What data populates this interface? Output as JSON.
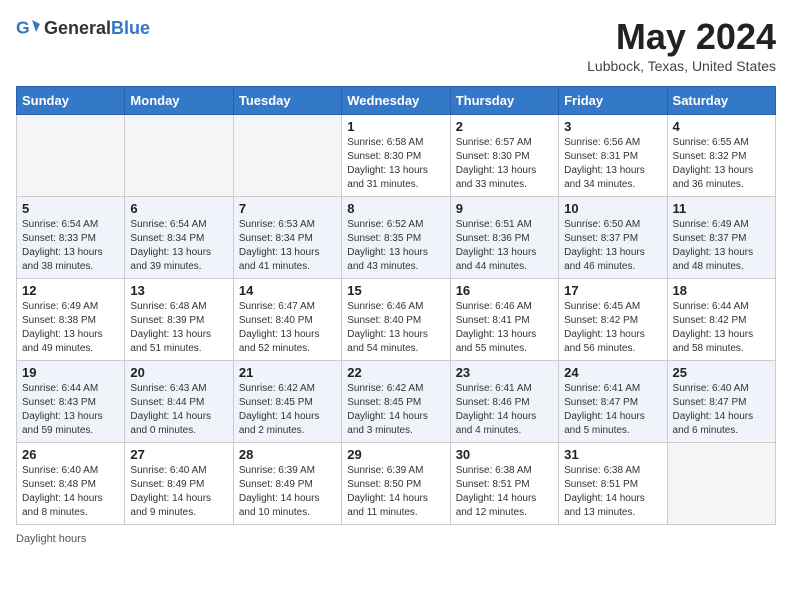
{
  "header": {
    "logo_general": "General",
    "logo_blue": "Blue",
    "month_title": "May 2024",
    "location": "Lubbock, Texas, United States"
  },
  "days_of_week": [
    "Sunday",
    "Monday",
    "Tuesday",
    "Wednesday",
    "Thursday",
    "Friday",
    "Saturday"
  ],
  "weeks": [
    [
      {
        "day": "",
        "info": ""
      },
      {
        "day": "",
        "info": ""
      },
      {
        "day": "",
        "info": ""
      },
      {
        "day": "1",
        "info": "Sunrise: 6:58 AM\nSunset: 8:30 PM\nDaylight: 13 hours\nand 31 minutes."
      },
      {
        "day": "2",
        "info": "Sunrise: 6:57 AM\nSunset: 8:30 PM\nDaylight: 13 hours\nand 33 minutes."
      },
      {
        "day": "3",
        "info": "Sunrise: 6:56 AM\nSunset: 8:31 PM\nDaylight: 13 hours\nand 34 minutes."
      },
      {
        "day": "4",
        "info": "Sunrise: 6:55 AM\nSunset: 8:32 PM\nDaylight: 13 hours\nand 36 minutes."
      }
    ],
    [
      {
        "day": "5",
        "info": "Sunrise: 6:54 AM\nSunset: 8:33 PM\nDaylight: 13 hours\nand 38 minutes."
      },
      {
        "day": "6",
        "info": "Sunrise: 6:54 AM\nSunset: 8:34 PM\nDaylight: 13 hours\nand 39 minutes."
      },
      {
        "day": "7",
        "info": "Sunrise: 6:53 AM\nSunset: 8:34 PM\nDaylight: 13 hours\nand 41 minutes."
      },
      {
        "day": "8",
        "info": "Sunrise: 6:52 AM\nSunset: 8:35 PM\nDaylight: 13 hours\nand 43 minutes."
      },
      {
        "day": "9",
        "info": "Sunrise: 6:51 AM\nSunset: 8:36 PM\nDaylight: 13 hours\nand 44 minutes."
      },
      {
        "day": "10",
        "info": "Sunrise: 6:50 AM\nSunset: 8:37 PM\nDaylight: 13 hours\nand 46 minutes."
      },
      {
        "day": "11",
        "info": "Sunrise: 6:49 AM\nSunset: 8:37 PM\nDaylight: 13 hours\nand 48 minutes."
      }
    ],
    [
      {
        "day": "12",
        "info": "Sunrise: 6:49 AM\nSunset: 8:38 PM\nDaylight: 13 hours\nand 49 minutes."
      },
      {
        "day": "13",
        "info": "Sunrise: 6:48 AM\nSunset: 8:39 PM\nDaylight: 13 hours\nand 51 minutes."
      },
      {
        "day": "14",
        "info": "Sunrise: 6:47 AM\nSunset: 8:40 PM\nDaylight: 13 hours\nand 52 minutes."
      },
      {
        "day": "15",
        "info": "Sunrise: 6:46 AM\nSunset: 8:40 PM\nDaylight: 13 hours\nand 54 minutes."
      },
      {
        "day": "16",
        "info": "Sunrise: 6:46 AM\nSunset: 8:41 PM\nDaylight: 13 hours\nand 55 minutes."
      },
      {
        "day": "17",
        "info": "Sunrise: 6:45 AM\nSunset: 8:42 PM\nDaylight: 13 hours\nand 56 minutes."
      },
      {
        "day": "18",
        "info": "Sunrise: 6:44 AM\nSunset: 8:42 PM\nDaylight: 13 hours\nand 58 minutes."
      }
    ],
    [
      {
        "day": "19",
        "info": "Sunrise: 6:44 AM\nSunset: 8:43 PM\nDaylight: 13 hours\nand 59 minutes."
      },
      {
        "day": "20",
        "info": "Sunrise: 6:43 AM\nSunset: 8:44 PM\nDaylight: 14 hours\nand 0 minutes."
      },
      {
        "day": "21",
        "info": "Sunrise: 6:42 AM\nSunset: 8:45 PM\nDaylight: 14 hours\nand 2 minutes."
      },
      {
        "day": "22",
        "info": "Sunrise: 6:42 AM\nSunset: 8:45 PM\nDaylight: 14 hours\nand 3 minutes."
      },
      {
        "day": "23",
        "info": "Sunrise: 6:41 AM\nSunset: 8:46 PM\nDaylight: 14 hours\nand 4 minutes."
      },
      {
        "day": "24",
        "info": "Sunrise: 6:41 AM\nSunset: 8:47 PM\nDaylight: 14 hours\nand 5 minutes."
      },
      {
        "day": "25",
        "info": "Sunrise: 6:40 AM\nSunset: 8:47 PM\nDaylight: 14 hours\nand 6 minutes."
      }
    ],
    [
      {
        "day": "26",
        "info": "Sunrise: 6:40 AM\nSunset: 8:48 PM\nDaylight: 14 hours\nand 8 minutes."
      },
      {
        "day": "27",
        "info": "Sunrise: 6:40 AM\nSunset: 8:49 PM\nDaylight: 14 hours\nand 9 minutes."
      },
      {
        "day": "28",
        "info": "Sunrise: 6:39 AM\nSunset: 8:49 PM\nDaylight: 14 hours\nand 10 minutes."
      },
      {
        "day": "29",
        "info": "Sunrise: 6:39 AM\nSunset: 8:50 PM\nDaylight: 14 hours\nand 11 minutes."
      },
      {
        "day": "30",
        "info": "Sunrise: 6:38 AM\nSunset: 8:51 PM\nDaylight: 14 hours\nand 12 minutes."
      },
      {
        "day": "31",
        "info": "Sunrise: 6:38 AM\nSunset: 8:51 PM\nDaylight: 14 hours\nand 13 minutes."
      },
      {
        "day": "",
        "info": ""
      }
    ]
  ],
  "footer": {
    "daylight_label": "Daylight hours"
  }
}
